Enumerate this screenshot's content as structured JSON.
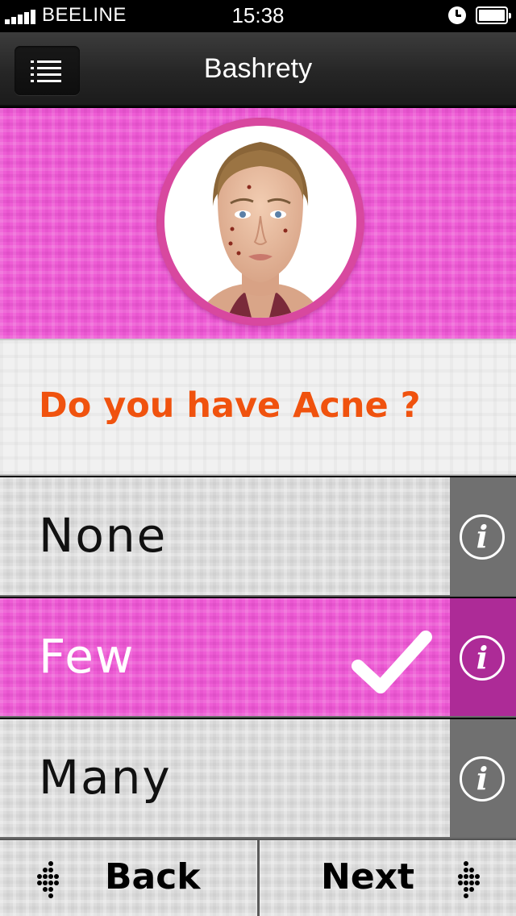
{
  "status_bar": {
    "carrier": "BEELINE",
    "time": "15:38"
  },
  "nav": {
    "title": "Bashrety"
  },
  "question": {
    "text": "Do you have Acne ?"
  },
  "options": [
    {
      "label": "None",
      "selected": false
    },
    {
      "label": "Few",
      "selected": true
    },
    {
      "label": "Many",
      "selected": false
    }
  ],
  "info_glyph": "i",
  "buttons": {
    "back": "Back",
    "next": "Next"
  },
  "colors": {
    "pink": "#ee5cd5",
    "accent_orange": "#f0520e",
    "selected_info": "#ad2b97",
    "info_grey": "#707070"
  },
  "icons": [
    "menu-icon",
    "alarm-icon",
    "battery-icon",
    "signal-icon",
    "info-icon",
    "checkmark-icon",
    "back-arrow-icon",
    "next-arrow-icon"
  ]
}
